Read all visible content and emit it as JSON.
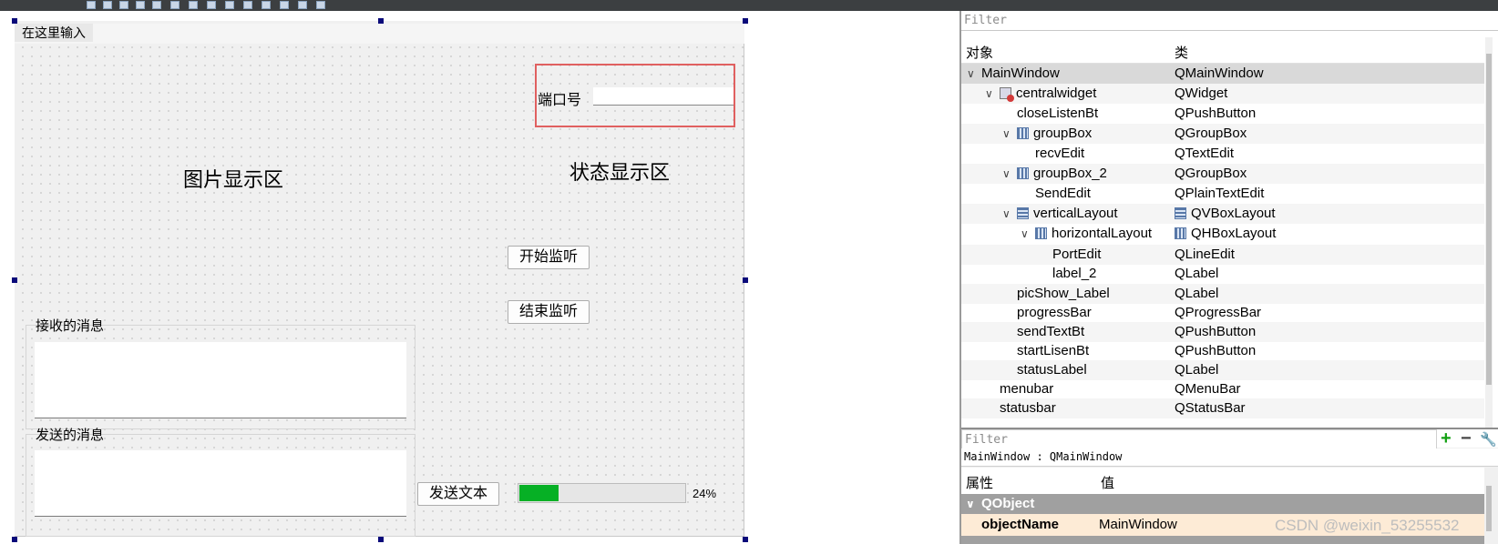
{
  "form": {
    "menu_item": "在这里输入",
    "pic_label": "图片显示区",
    "status_label": "状态显示区",
    "port_label": "端口号",
    "port_value": "",
    "start_button": "开始监听",
    "stop_button": "结束监听",
    "recv_group_title": "接收的消息",
    "send_group_title": "发送的消息",
    "send_button": "发送文本",
    "progress_value": 24,
    "progress_text": "24%"
  },
  "object_inspector": {
    "filter_placeholder": "Filter",
    "col_object": "对象",
    "col_class": "类",
    "rows": [
      {
        "name": "MainWindow",
        "cls": "QMainWindow"
      },
      {
        "name": "centralwidget",
        "cls": "QWidget"
      },
      {
        "name": "closeListenBt",
        "cls": "QPushButton"
      },
      {
        "name": "groupBox",
        "cls": "QGroupBox"
      },
      {
        "name": "recvEdit",
        "cls": "QTextEdit"
      },
      {
        "name": "groupBox_2",
        "cls": "QGroupBox"
      },
      {
        "name": "SendEdit",
        "cls": "QPlainTextEdit"
      },
      {
        "name": "verticalLayout",
        "cls": "QVBoxLayout"
      },
      {
        "name": "horizontalLayout",
        "cls": "QHBoxLayout"
      },
      {
        "name": "PortEdit",
        "cls": "QLineEdit"
      },
      {
        "name": "label_2",
        "cls": "QLabel"
      },
      {
        "name": "picShow_Label",
        "cls": "QLabel"
      },
      {
        "name": "progressBar",
        "cls": "QProgressBar"
      },
      {
        "name": "sendTextBt",
        "cls": "QPushButton"
      },
      {
        "name": "startLisenBt",
        "cls": "QPushButton"
      },
      {
        "name": "statusLabel",
        "cls": "QLabel"
      },
      {
        "name": "menubar",
        "cls": "QMenuBar"
      },
      {
        "name": "statusbar",
        "cls": "QStatusBar"
      }
    ]
  },
  "property_editor": {
    "filter_placeholder": "Filter",
    "plus_symbol": "+",
    "minus_symbol": "−",
    "wrench_symbol": "🔧",
    "caption": "MainWindow : QMainWindow",
    "col_property": "属性",
    "col_value": "值",
    "group_qobject": "QObject",
    "prop_name": "objectName",
    "prop_value": "MainWindow"
  },
  "watermark": "CSDN @weixin_53255532",
  "colors": {
    "progress_fill": "#06b025",
    "selection_red": "#e06060",
    "selected_row": "#d9d9d9"
  }
}
